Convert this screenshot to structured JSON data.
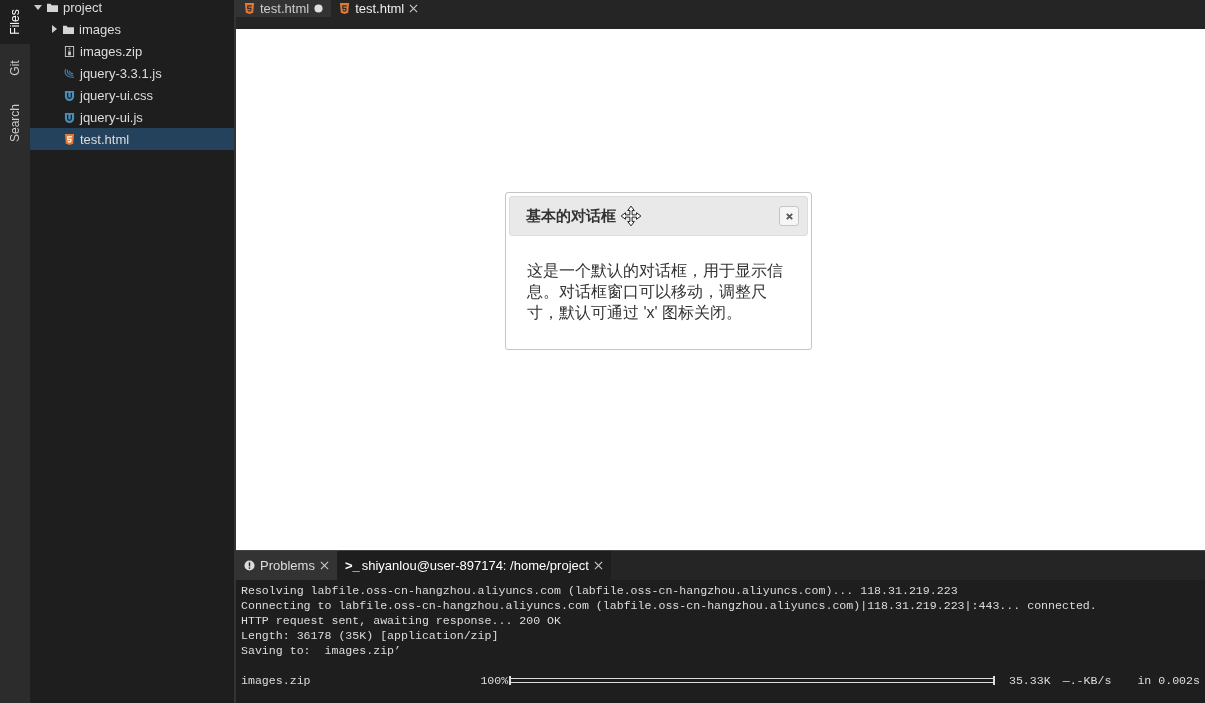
{
  "activity_bar": [
    {
      "label": "Files",
      "selected": true
    },
    {
      "label": "Git",
      "selected": false
    },
    {
      "label": "Search",
      "selected": false
    }
  ],
  "file_tree": [
    {
      "name": "project",
      "kind": "folder",
      "expanded": true,
      "selected": false,
      "children": [
        {
          "name": "images",
          "kind": "folder",
          "expanded": false,
          "selected": false
        },
        {
          "name": "images.zip",
          "kind": "zip",
          "selected": false
        },
        {
          "name": "jquery-3.3.1.js",
          "kind": "jquery",
          "selected": false
        },
        {
          "name": "jquery-ui.css",
          "kind": "jqueryui",
          "selected": false
        },
        {
          "name": "jquery-ui.js",
          "kind": "jqueryui",
          "selected": false
        },
        {
          "name": "test.html",
          "kind": "html",
          "selected": true
        }
      ]
    }
  ],
  "editor_tabs": [
    {
      "label": "test.html",
      "modified": true,
      "selected": false
    },
    {
      "label": "test.html",
      "modified": false,
      "selected": true
    }
  ],
  "dialog": {
    "title": "基本的对话框",
    "body": "这是一个默认的对话框，用于显示信息。对话框窗口可以移动，调整尺寸，默认可通过 'x' 图标关闭。"
  },
  "panel_tabs": [
    {
      "label": "Problems",
      "kind": "problems",
      "selected": false
    },
    {
      "label": "shiyanlou@user-897174: /home/project",
      "kind": "terminal",
      "prompt": ">_",
      "selected": true
    }
  ],
  "terminal": {
    "lines": [
      "Resolving labfile.oss-cn-hangzhou.aliyuncs.com (labfile.oss-cn-hangzhou.aliyuncs.com)... 118.31.219.223",
      "Connecting to labfile.oss-cn-hangzhou.aliyuncs.com (labfile.oss-cn-hangzhou.aliyuncs.com)|118.31.219.223|:443... connected.",
      "HTTP request sent, awaiting response... 200 OK",
      "Length: 36178 (35K) [application/zip]",
      "Saving to:  images.zip’"
    ],
    "progress": {
      "file": "images.zip",
      "percent": "100%",
      "level": 1,
      "size": "35.33K",
      "speed": "—.-KB/s",
      "time": "in 0.002s"
    }
  }
}
